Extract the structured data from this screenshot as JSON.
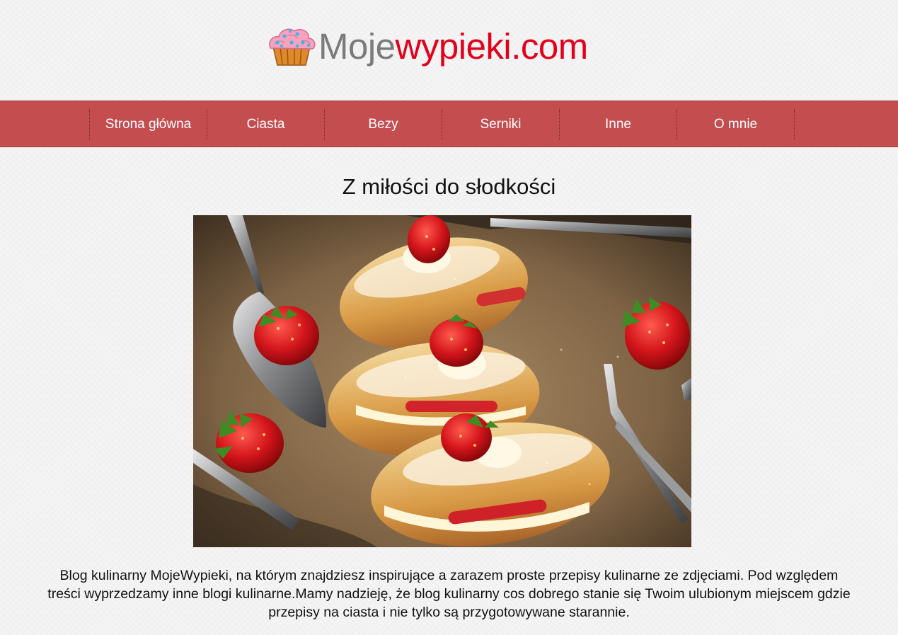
{
  "header": {
    "logo_part1": "Moje",
    "logo_part2": "wypieki.com",
    "logo_icon": "cupcake-icon"
  },
  "nav": {
    "items": [
      {
        "label": "Strona główna"
      },
      {
        "label": "Ciasta"
      },
      {
        "label": "Bezy"
      },
      {
        "label": "Serniki"
      },
      {
        "label": "Inne"
      },
      {
        "label": "O mnie"
      }
    ]
  },
  "main": {
    "title": "Z miłości do słodkości",
    "intro": "Blog kulinarny MojeWypieki, na którym znajdziesz inspirujące a zarazem proste przepisy kulinarne ze zdjęciami. Pod względem treści wyprzedzamy inne blogi kulinarne.Mamy nadzieję, że blog kulinarny cos dobrego stanie się Twoim ulubionym miejscem gdzie przepisy na ciasta i nie tylko są przygotowywane starannie."
  },
  "colors": {
    "nav_bg": "#c44d50",
    "logo_grey": "#7b7b7b",
    "logo_red": "#e2001a"
  }
}
